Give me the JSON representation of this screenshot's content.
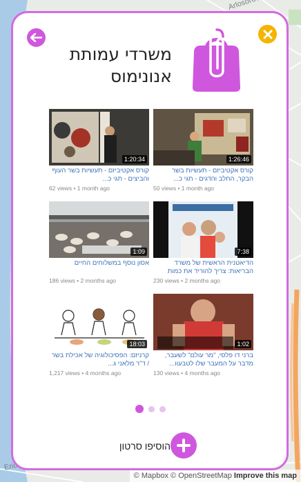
{
  "map": {
    "labels": [
      "Arlosorov",
      "Erich"
    ],
    "attribution": {
      "mapbox": "© Mapbox",
      "osm": "© OpenStreetMap",
      "improve": "Improve this map"
    },
    "colors": {
      "water": "#a9cbe8",
      "road": "#f4a55e",
      "land": "#e9ebe7"
    }
  },
  "colors": {
    "accent": "#cf57de",
    "close": "#f4b400",
    "link": "#3b71b8"
  },
  "header": {
    "title_line1": "משרדי עמותת",
    "title_line2": "אנונימוס",
    "back_icon": "arrow-left-icon",
    "close_icon": "close-icon",
    "logo_icon": "shopping-bag-paperclip-icon"
  },
  "videos": [
    {
      "title": "קורס אקטיביזם - תעשיות בשר הבקר, החלב והדגים - תגי כ...",
      "duration": "1:26:46",
      "views": "50 views",
      "age": "1 month ago"
    },
    {
      "title": "קורס אקטיביזם - תעשיות בשר העוף והביצים - תגי כ...",
      "duration": "1:20:34",
      "views": "62 views",
      "age": "1 month ago"
    },
    {
      "title": "הדיאטנית הראשית של משרד הבריאות: צריך להוריד את כמות הבשר שאוכל...",
      "duration": "7:38",
      "views": "230 views",
      "age": "2 months ago"
    },
    {
      "title": "אסון נוסף במשלוחים החיים",
      "duration": "1:09",
      "views": "186 views",
      "age": "2 months ago"
    },
    {
      "title": "ברני דו פלסי, \"מר עולם\" לשעבר, מדבר על המעבר שלו לטבעוו...",
      "duration": "1:02",
      "views": "130 views",
      "age": "4 months ago"
    },
    {
      "title": "קרניזם: הפסיכולוגיה של אכילת בשר / ד\"ר מלאני ג...",
      "duration": "18:03",
      "views": "1,217 views",
      "age": "4 months ago"
    }
  ],
  "pagination": {
    "pages": 3,
    "current": 1
  },
  "add_video": {
    "label": "הוסיפו סרטון",
    "icon": "plus-icon"
  }
}
